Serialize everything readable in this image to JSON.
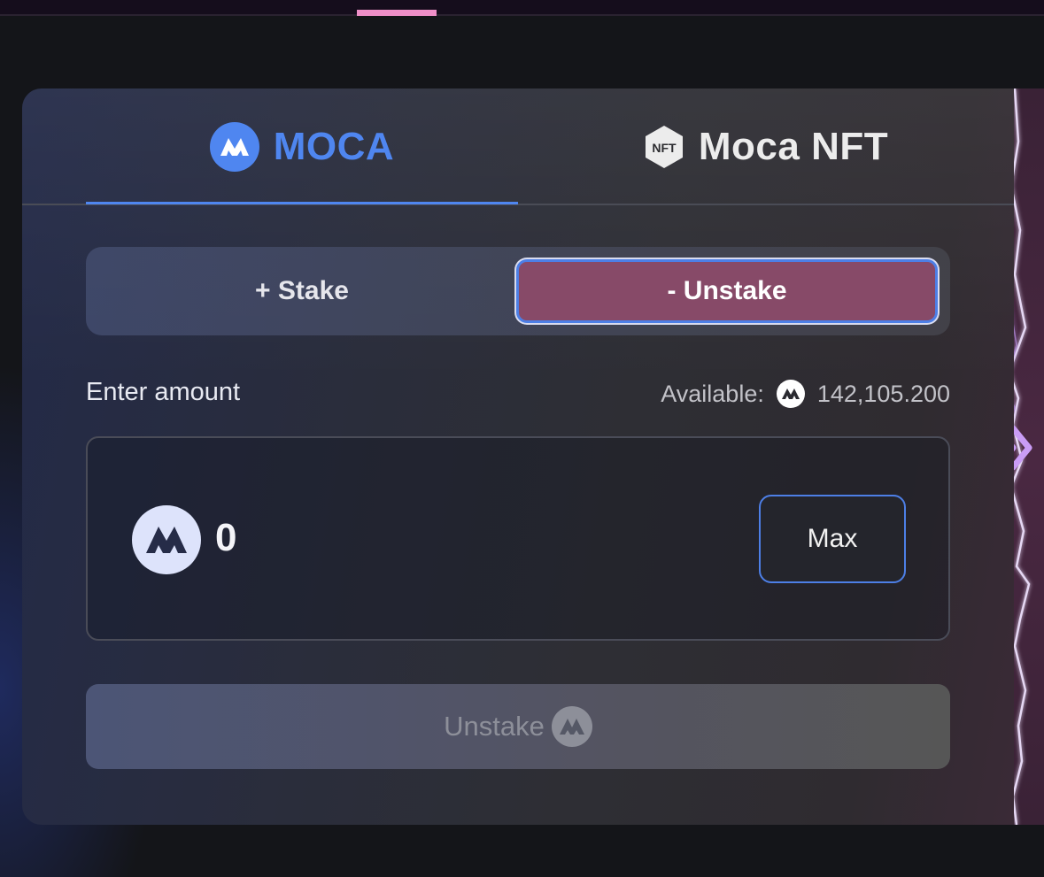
{
  "tabs": {
    "moca_label": "MOCA",
    "nft_label": "Moca NFT",
    "nft_badge": "NFT",
    "active": "MOCA"
  },
  "mode": {
    "stake_label": "+ Stake",
    "unstake_label": "- Unstake",
    "active": "unstake"
  },
  "amount": {
    "label": "Enter amount",
    "available_label": "Available:",
    "available_value": "142,105.200",
    "value": "0",
    "max_label": "Max"
  },
  "action": {
    "label": "Unstake",
    "disabled": true
  },
  "icons": {
    "token": "moca-token-icon",
    "nft": "nft-hexagon-icon",
    "sidebar_toggle": "double-chevron-right-icon"
  },
  "colors": {
    "accent_blue": "#4f86f0",
    "unstake_active": "#874a68",
    "top_indicator": "#ef8fc8",
    "chevron": "#c99cf5"
  }
}
